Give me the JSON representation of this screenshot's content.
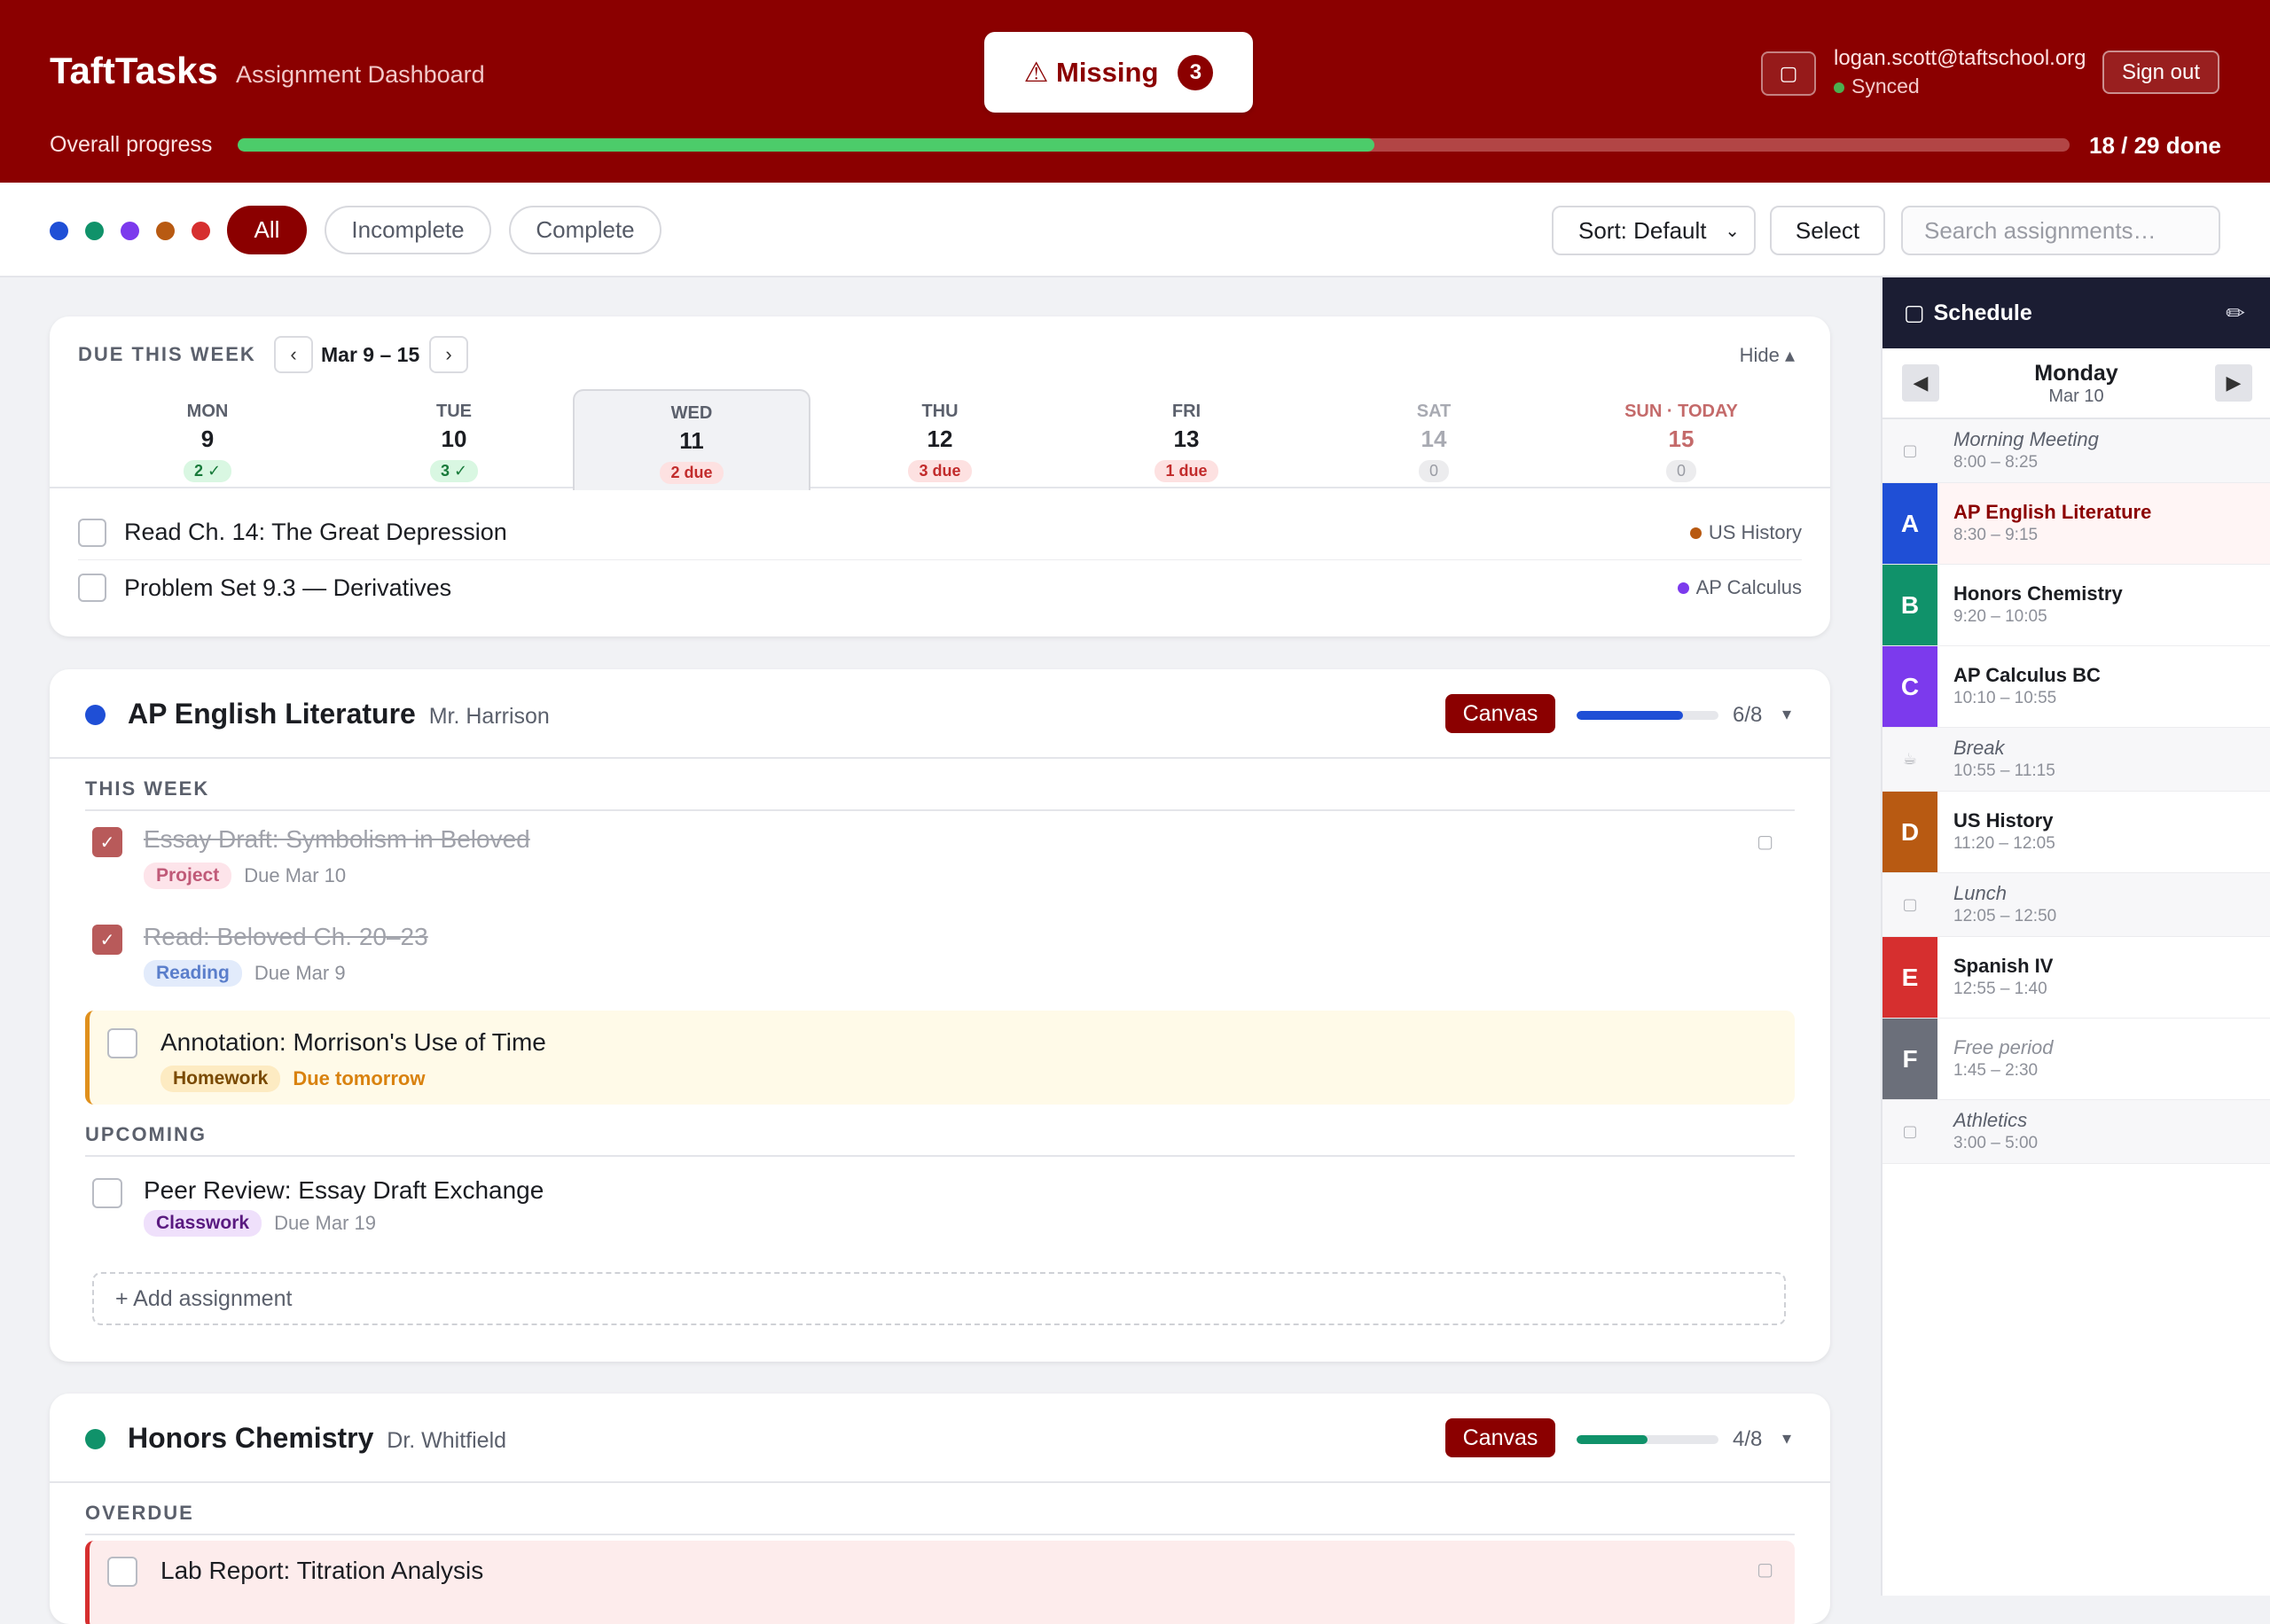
{
  "header": {
    "brand": "TaftTasks",
    "subtitle": "Assignment Dashboard",
    "missing_label": "⚠ Missing",
    "missing_count": "3",
    "user_email": "logan.scott@taftschool.org",
    "sync_status": "Synced",
    "sign_out_label": "Sign out",
    "progress_label": "Overall progress",
    "progress_done": 18,
    "progress_total": 29,
    "progress_text": "18 / 29 done",
    "icon_button": "notifications-icon"
  },
  "toolbar": {
    "course_colors": [
      "#1f4fd6",
      "#10926a",
      "#7c3aed",
      "#b85a12",
      "#d62f2f"
    ],
    "filters": [
      "All",
      "Incomplete",
      "Complete"
    ],
    "active_filter": "All",
    "sort_label": "Sort: Default",
    "select_label": "Select",
    "search_placeholder": "Search assignments…"
  },
  "week": {
    "title": "DUE THIS WEEK",
    "range": "Mar 9 – 15",
    "prev": "‹",
    "next": "›",
    "hide_label": "Hide ▴",
    "days": [
      {
        "name": "MON",
        "date": "9",
        "badge": "2 ✓",
        "kind": "ok"
      },
      {
        "name": "TUE",
        "date": "10",
        "badge": "3 ✓",
        "kind": "ok"
      },
      {
        "name": "WED",
        "date": "11",
        "badge": "2 due",
        "kind": "due",
        "selected": true
      },
      {
        "name": "THU",
        "date": "12",
        "badge": "3 due",
        "kind": "due"
      },
      {
        "name": "FRI",
        "date": "13",
        "badge": "1 due",
        "kind": "due"
      },
      {
        "name": "SAT",
        "date": "14",
        "badge": "0",
        "kind": "zero"
      },
      {
        "name": "SUN · TODAY",
        "date": "15",
        "badge": "0",
        "kind": "zero"
      }
    ],
    "items": [
      {
        "title": "Read Ch. 14: The Great Depression",
        "course": "US History",
        "color": "#b85a12"
      },
      {
        "title": "Problem Set 9.3 — Derivatives",
        "course": "AP Calculus",
        "color": "#7c3aed"
      }
    ]
  },
  "courses": [
    {
      "name": "AP English Literature",
      "teacher": "Mr. Harrison",
      "color": "#1f4fd6",
      "canvas_label": "Canvas",
      "done": 6,
      "total": 8,
      "count_text": "6/8",
      "caret": "▾",
      "sections": {
        "this_week": "THIS WEEK",
        "upcoming": "UPCOMING"
      },
      "items": [
        {
          "title": "Essay Draft: Symbolism in Beloved",
          "tag": "Project",
          "due": "Due Mar 10",
          "done": true
        },
        {
          "title": "Read: Beloved Ch. 20–23",
          "tag": "Reading",
          "due": "Due Mar 9",
          "done": true
        },
        {
          "title": "Annotation: Morrison's Use of Time",
          "tag": "Homework",
          "due": "Due tomorrow",
          "done": false
        },
        {
          "title": "Peer Review: Essay Draft Exchange",
          "tag": "Classwork",
          "due": "Due Mar 19",
          "done": false
        }
      ],
      "add_label": "+ Add assignment"
    },
    {
      "name": "Honors Chemistry",
      "teacher": "Dr. Whitfield",
      "color": "#10926a",
      "canvas_label": "Canvas",
      "done": 4,
      "total": 8,
      "count_text": "4/8",
      "caret": "▾",
      "sections": {
        "overdue": "OVERDUE"
      },
      "items": [
        {
          "title": "Lab Report: Titration Analysis",
          "done": false
        }
      ]
    }
  ],
  "schedule": {
    "title": "Schedule",
    "edit_icon": "pencil-icon",
    "edit_glyph": "✏",
    "day": "Monday",
    "date": "Mar 10",
    "prev": "◀",
    "next": "▶",
    "periods": [
      {
        "name": "Morning Meeting",
        "time": "8:00 – 8:25",
        "minor": true
      },
      {
        "letter": "A",
        "name": "AP English Literature",
        "time": "8:30 – 9:15",
        "color": "#1f4fd6",
        "current": true
      },
      {
        "letter": "B",
        "name": "Honors Chemistry",
        "time": "9:20 – 10:05",
        "color": "#10926a"
      },
      {
        "letter": "C",
        "name": "AP Calculus BC",
        "time": "10:10 – 10:55",
        "color": "#7c3aed"
      },
      {
        "name": "Break",
        "time": "10:55 – 11:15",
        "minor": true,
        "icon": "☕"
      },
      {
        "letter": "D",
        "name": "US History",
        "time": "11:20 – 12:05",
        "color": "#b85a12"
      },
      {
        "name": "Lunch",
        "time": "12:05 – 12:50",
        "minor": true
      },
      {
        "letter": "E",
        "name": "Spanish IV",
        "time": "12:55 – 1:40",
        "color": "#d62f2f"
      },
      {
        "letter": "F",
        "name": "Free period",
        "time": "1:45 – 2:30",
        "color": "#6b6f7a",
        "free": true
      },
      {
        "name": "Athletics",
        "time": "3:00 – 5:00",
        "minor": true
      }
    ]
  }
}
